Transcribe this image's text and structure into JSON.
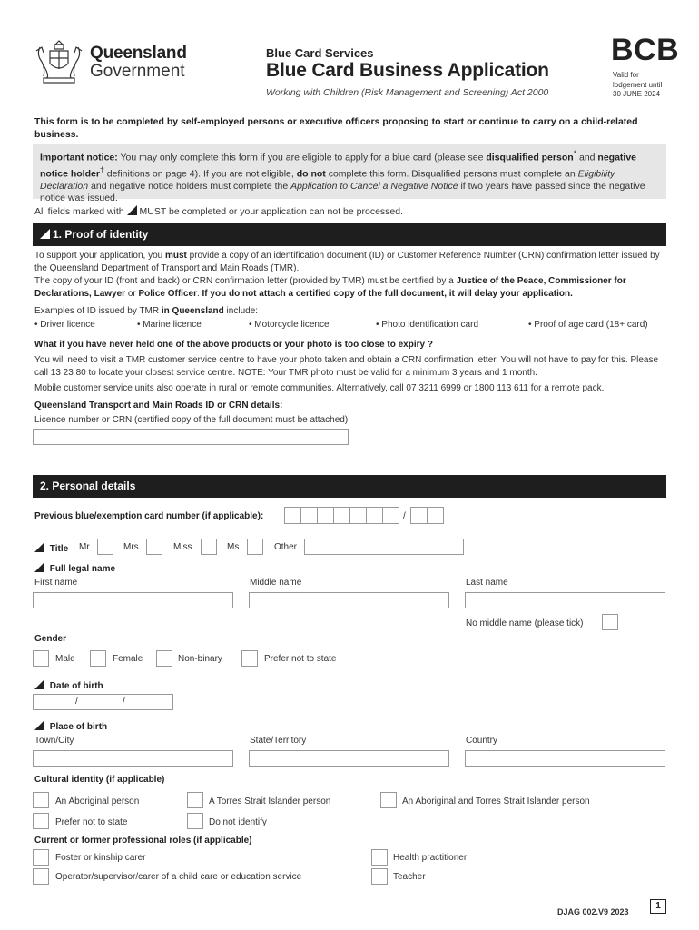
{
  "header": {
    "logo_line1": "Queensland",
    "logo_line2": "Government",
    "service": "Blue Card Services",
    "title": "Blue Card Business Application",
    "act": "Working with Children (Risk Management and Screening) Act 2000",
    "form_code": "BCB",
    "valid_line1": "Valid for",
    "valid_line2": "lodgement until",
    "valid_line3": "30 JUNE 2024"
  },
  "intro": "This form is to be completed by self-employed persons or executive officers proposing to start or continue to carry on a child-related business.",
  "notice": {
    "label": "Important notice:",
    "t1": " You may only complete this form if you are eligible to apply for a blue card (please see ",
    "b1": "disqualified person",
    "sup1": "*",
    "t2": " and ",
    "b2": "negative notice holder",
    "sup2": "†",
    "t3": " definitions on page 4). If you are not eligible, ",
    "b3": "do not",
    "t4": " complete this form. Disqualified persons must complete an ",
    "i1": "Eligibility Declaration",
    "t5": " and negative notice holders must complete the ",
    "i2": "Application to Cancel a Negative Notice",
    "t6": " if two years have passed since the negative notice was issued."
  },
  "all_fields": {
    "before": "All fields marked with ",
    "after": "MUST be completed or your application can not be processed."
  },
  "section1": {
    "title": "1. Proof of identity",
    "p1_a": "To support your application, you ",
    "p1_b": "must",
    "p1_c": " provide a copy of an identification document (ID) or Customer Reference Number (CRN) confirmation letter issued by the Queensland Department of Transport and Main Roads (TMR).",
    "p2_a": "The copy of your ID (front and back) or CRN confirmation letter (provided by TMR) must be certified by a ",
    "p2_b": "Justice of the Peace, Commissioner for Declarations, Lawyer",
    "p2_c": " or ",
    "p2_d": "Police Officer",
    "p2_e": ". ",
    "p2_f": "If you do not attach a certified copy of the full document, it will delay your application.",
    "p3_a": "Examples of ID issued by TMR ",
    "p3_b": "in Queensland",
    "p3_c": " include:",
    "id_examples": [
      "• Driver licence",
      "• Marine licence",
      "• Motorcycle licence",
      "• Photo identification card",
      "• Proof of age card (18+ card)"
    ],
    "q_heading": "What if you have never held one of the above products or your photo is too close to expiry ?",
    "p4": "You will need to visit a TMR customer service centre to have your photo taken and obtain a CRN confirmation letter. You will not have to pay for this. Please call 13 23 80 to locate your closest service centre. NOTE: Your TMR photo must be valid for a minimum 3 years and 1 month.",
    "p5": "Mobile customer service units also operate in rural or remote communities. Alternatively, call 07 3211 6999 or 1800 113 611 for a remote pack.",
    "tmr_heading": "Queensland Transport and Main Roads ID or CRN details:",
    "licence_label": "Licence number or CRN (certified copy of the full document must be attached):",
    "licence_value": ""
  },
  "section2": {
    "title": "2. Personal details",
    "card_number_label": "Previous blue/exemption card number (if applicable):",
    "card_separator": "/",
    "title_label": "Title",
    "title_options": [
      "Mr",
      "Mrs",
      "Miss",
      "Ms"
    ],
    "title_other": "Other",
    "full_name_heading": "Full legal name",
    "first_name": "First name",
    "middle_name": "Middle name",
    "last_name": "Last name",
    "no_middle_name": "No middle name (please tick)",
    "gender_heading": "Gender",
    "gender_options": [
      "Male",
      "Female",
      "Non-binary",
      "Prefer not to state"
    ],
    "dob_heading": "Date of birth",
    "dob_sep": "/",
    "pob_heading": "Place of birth",
    "town": "Town/City",
    "state": "State/Territory",
    "country": "Country",
    "cultural_heading": "Cultural identity (if applicable)",
    "cultural_options": [
      "An Aboriginal person",
      "A Torres Strait Islander person",
      "An Aboriginal and Torres Strait Islander person",
      "Prefer not to state",
      "Do not identify"
    ],
    "roles_heading": "Current or former professional roles (if applicable)",
    "roles_options": [
      "Foster or kinship carer",
      "Health practitioner",
      "Operator/supervisor/carer of a child care or education service",
      "Teacher"
    ]
  },
  "footer": {
    "code": "DJAG 002.V9 2023",
    "page": "1"
  }
}
